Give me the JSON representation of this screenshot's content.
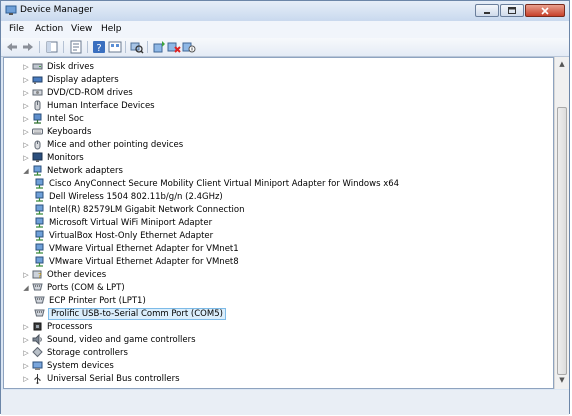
{
  "window": {
    "title": "Device Manager"
  },
  "menu": [
    "File",
    "Action",
    "View",
    "Help"
  ],
  "toolbar": [
    "back-icon",
    "forward-icon",
    "show-hide-tree-icon",
    "properties-icon",
    "help-icon",
    "view-icon",
    "scan-hardware-icon",
    "update-driver-icon",
    "uninstall-icon",
    "disable-icon"
  ],
  "tree": [
    {
      "label": "Disk drives",
      "level": 1,
      "expander": "collapsed",
      "icon": "disk-drive-icon"
    },
    {
      "label": "Display adapters",
      "level": 1,
      "expander": "collapsed",
      "icon": "display-adapter-icon"
    },
    {
      "label": "DVD/CD-ROM drives",
      "level": 1,
      "expander": "collapsed",
      "icon": "dvd-drive-icon"
    },
    {
      "label": "Human Interface Devices",
      "level": 1,
      "expander": "collapsed",
      "icon": "hid-icon"
    },
    {
      "label": "Intel Soc",
      "level": 1,
      "expander": "collapsed",
      "icon": "network-device-icon"
    },
    {
      "label": "Keyboards",
      "level": 1,
      "expander": "collapsed",
      "icon": "keyboard-icon"
    },
    {
      "label": "Mice and other pointing devices",
      "level": 1,
      "expander": "collapsed",
      "icon": "mouse-icon"
    },
    {
      "label": "Monitors",
      "level": 1,
      "expander": "collapsed",
      "icon": "monitor-icon"
    },
    {
      "label": "Network adapters",
      "level": 1,
      "expander": "expanded",
      "icon": "network-adapter-icon"
    },
    {
      "label": "Cisco AnyConnect Secure Mobility Client Virtual Miniport Adapter for Windows x64",
      "level": 2,
      "expander": "none",
      "icon": "network-adapter-icon"
    },
    {
      "label": "Dell Wireless 1504 802.11b/g/n (2.4GHz)",
      "level": 2,
      "expander": "none",
      "icon": "network-adapter-icon"
    },
    {
      "label": "Intel(R) 82579LM Gigabit Network Connection",
      "level": 2,
      "expander": "none",
      "icon": "network-adapter-icon"
    },
    {
      "label": "Microsoft Virtual WiFi Miniport Adapter",
      "level": 2,
      "expander": "none",
      "icon": "network-adapter-icon"
    },
    {
      "label": "VirtualBox Host-Only Ethernet Adapter",
      "level": 2,
      "expander": "none",
      "icon": "network-adapter-icon"
    },
    {
      "label": "VMware Virtual Ethernet Adapter for VMnet1",
      "level": 2,
      "expander": "none",
      "icon": "network-adapter-icon"
    },
    {
      "label": "VMware Virtual Ethernet Adapter for VMnet8",
      "level": 2,
      "expander": "none",
      "icon": "network-adapter-icon"
    },
    {
      "label": "Other devices",
      "level": 1,
      "expander": "collapsed",
      "icon": "other-device-icon"
    },
    {
      "label": "Ports (COM & LPT)",
      "level": 1,
      "expander": "expanded",
      "icon": "port-icon"
    },
    {
      "label": "ECP Printer Port (LPT1)",
      "level": 2,
      "expander": "none",
      "icon": "port-icon"
    },
    {
      "label": "Prolific USB-to-Serial Comm Port (COM5)",
      "level": 2,
      "expander": "none",
      "icon": "port-icon",
      "selected": true
    },
    {
      "label": "Processors",
      "level": 1,
      "expander": "collapsed",
      "icon": "processor-icon"
    },
    {
      "label": "Sound, video and game controllers",
      "level": 1,
      "expander": "collapsed",
      "icon": "sound-icon"
    },
    {
      "label": "Storage controllers",
      "level": 1,
      "expander": "collapsed",
      "icon": "storage-controller-icon"
    },
    {
      "label": "System devices",
      "level": 1,
      "expander": "collapsed",
      "icon": "system-device-icon"
    },
    {
      "label": "Universal Serial Bus controllers",
      "level": 1,
      "expander": "collapsed",
      "icon": "usb-icon"
    }
  ],
  "colors": {
    "selection_bg": "#dbeefc",
    "selection_border": "#7dbbe8",
    "frame": "#dbe6f3"
  }
}
